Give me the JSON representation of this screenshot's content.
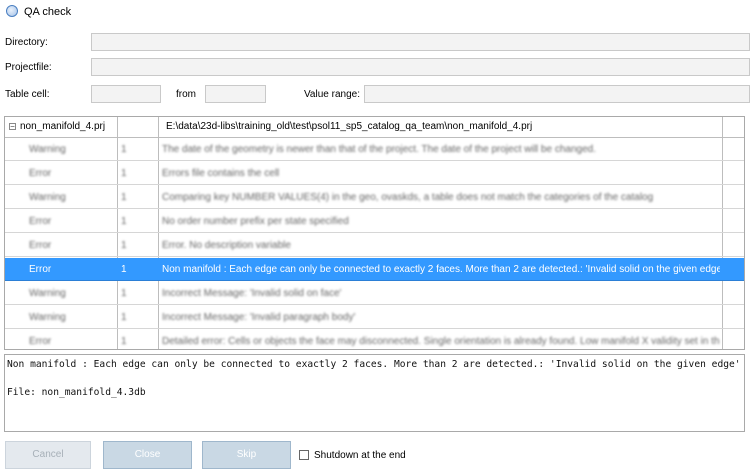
{
  "window": {
    "title": "QA check"
  },
  "form": {
    "directory_label": "Directory:",
    "projectfile_label": "Projectfile:",
    "tablecell_label": "Table cell:",
    "from_label": "from",
    "valuerange_label": "Value range:"
  },
  "grid": {
    "root_name": "non_manifold_4.prj",
    "root_path": "E:\\data\\23d-libs\\training_old\\test\\psol11_sp5_catalog_qa_team\\non_manifold_4.prj",
    "rows": [
      {
        "type": "Warning",
        "count": "1",
        "message": "The date of the geometry is newer than that of the project. The date of the project will be changed."
      },
      {
        "type": "Error",
        "count": "1",
        "message": "Errors file contains the cell"
      },
      {
        "type": "Warning",
        "count": "1",
        "message": "Comparing key NUMBER VALUES(4) in the geo, ovaskds, a table does not match the categories of the catalog"
      },
      {
        "type": "Error",
        "count": "1",
        "message": "No order number prefix per state specified"
      },
      {
        "type": "Error",
        "count": "1",
        "message": "Error. No description variable"
      },
      {
        "type": "Error",
        "count": "1",
        "message": "Non manifold : Each edge can only be connected to exactly 2 faces. More than 2 are detected.: 'Invalid solid on the given edge'",
        "selected": true
      },
      {
        "type": "Warning",
        "count": "1",
        "message": "Incorrect Message: 'Invalid solid on face'"
      },
      {
        "type": "Warning",
        "count": "1",
        "message": "Incorrect Message: 'Invalid paragraph body'"
      },
      {
        "type": "Error",
        "count": "1",
        "message": "Detailed error: Cells or objects the face may disconnected. Single orientation is already found. Low manifold X validity set in the"
      }
    ]
  },
  "message": {
    "line1": "Non manifold : Each edge can only be connected to exactly 2 faces. More than 2 are detected.: 'Invalid solid on the given edge'",
    "line2": "File: non_manifold_4.3db"
  },
  "buttons": {
    "cancel": "Cancel",
    "close": "Close",
    "skip": "Skip"
  },
  "checkbox": {
    "label": "Shutdown at the end",
    "checked": false
  }
}
